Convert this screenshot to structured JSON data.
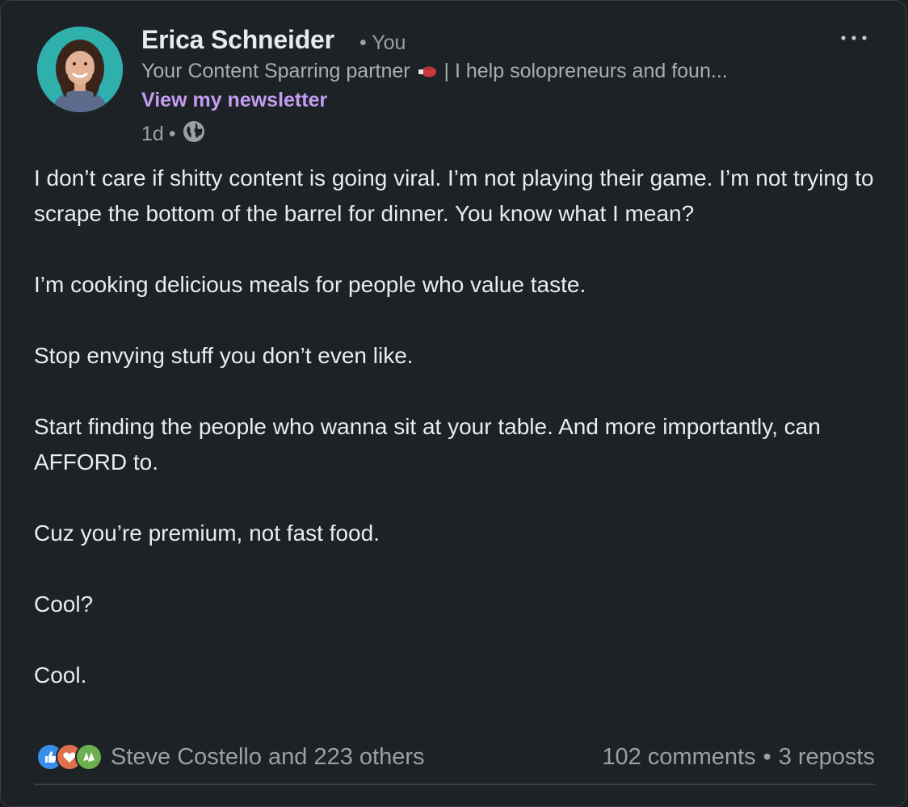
{
  "author": {
    "name": "Erica Schneider",
    "you_tag": "• You",
    "headline_before_icon": "Your Content Sparring partner",
    "headline_after_icon": "| I help solopreneurs and foun...",
    "newsletter_link": "View my newsletter",
    "time": "1d",
    "meta_sep": "•"
  },
  "icons": {
    "headline_icon": "boxing-glove-icon",
    "visibility": "globe-icon",
    "menu": "more-options-icon",
    "reactions": [
      "like-icon",
      "love-icon",
      "celebrate-icon"
    ]
  },
  "colors": {
    "background": "#1d2226",
    "link": "#c69cf2",
    "like": "#378fe9",
    "love": "#df704d",
    "celebrate": "#6dae4f"
  },
  "body": {
    "p1": "I don’t care if shitty content is going viral. I’m not playing their game. I’m not trying to scrape the bottom of the barrel for dinner. You know what I mean?",
    "p2": "I’m cooking delicious meals for people who value taste.",
    "p3": "Stop envying stuff you don’t even like.",
    "p4": "Start finding the people who wanna sit at your table. And more importantly, can AFFORD to.",
    "p5": "Cuz you’re premium, not fast food.",
    "p6": "Cool?",
    "p7": "Cool."
  },
  "footer": {
    "reactions_label": "Steve Costello and 223 others",
    "comments": "102 comments",
    "sep": "•",
    "reposts": "3 reposts"
  }
}
